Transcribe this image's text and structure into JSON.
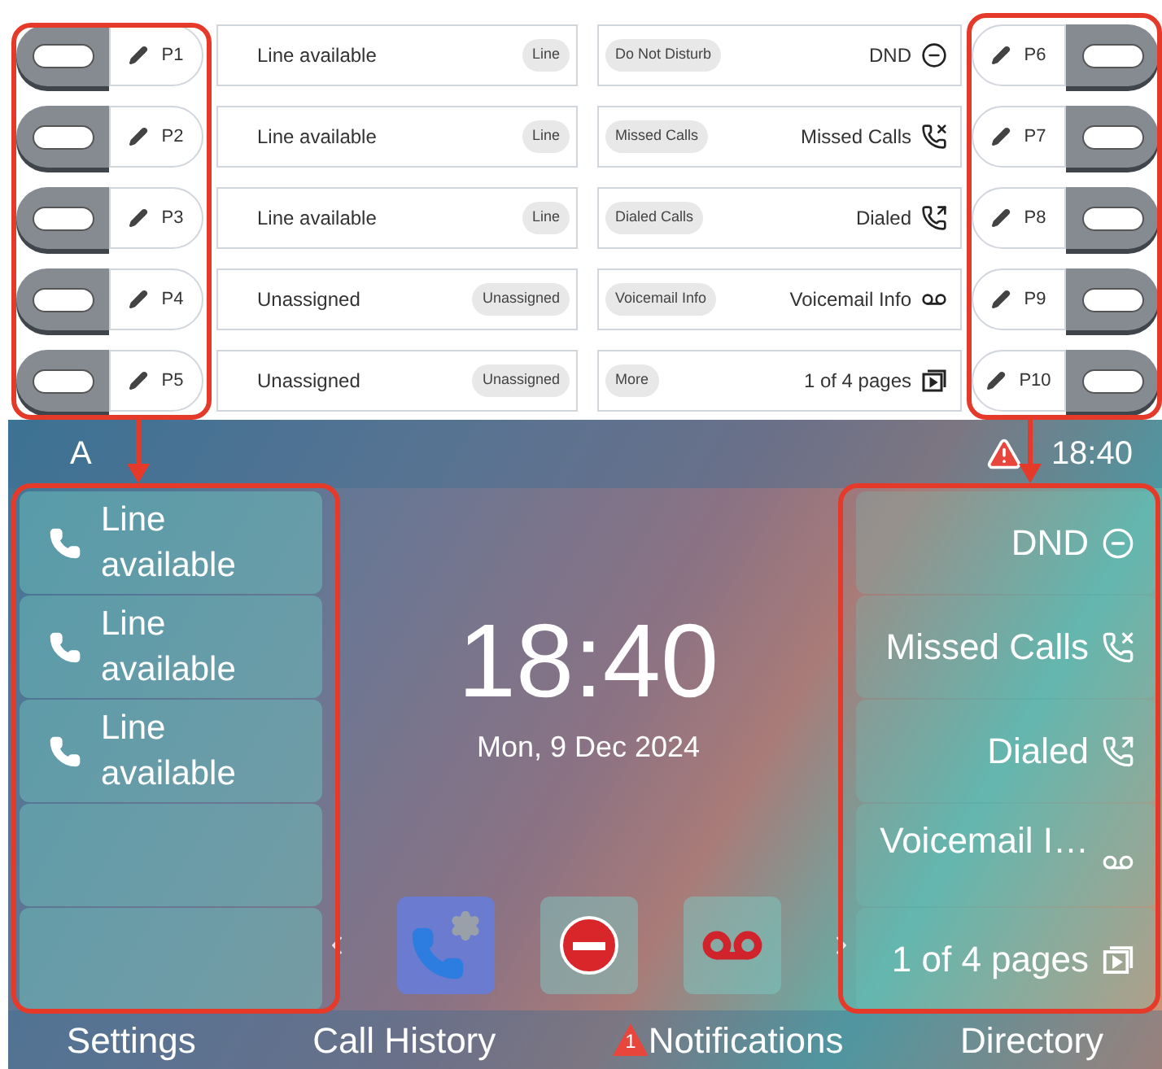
{
  "config_keys": {
    "left": [
      {
        "key": "P1",
        "label": "Line available",
        "type": "Line"
      },
      {
        "key": "P2",
        "label": "Line available",
        "type": "Line"
      },
      {
        "key": "P3",
        "label": "Line available",
        "type": "Line"
      },
      {
        "key": "P4",
        "label": "Unassigned",
        "type": "Unassigned"
      },
      {
        "key": "P5",
        "label": "Unassigned",
        "type": "Unassigned"
      }
    ],
    "right": [
      {
        "key": "P6",
        "type": "Do Not Disturb",
        "label": "DND",
        "kind": "dnd"
      },
      {
        "key": "P7",
        "type": "Missed Calls",
        "label": "Missed Calls",
        "kind": "missed"
      },
      {
        "key": "P8",
        "type": "Dialed Calls",
        "label": "Dialed",
        "kind": "dialed"
      },
      {
        "key": "P9",
        "type": "Voicemail Info",
        "label": "Voicemail Info",
        "kind": "voicemail"
      },
      {
        "key": "P10",
        "type": "More",
        "label": "1 of 4 pages",
        "kind": "pages"
      }
    ]
  },
  "phone_screen": {
    "account": "A",
    "warning": true,
    "time": "18:40",
    "line_keys": [
      {
        "label": "Line available",
        "kind": "line"
      },
      {
        "label": "Line available",
        "kind": "line"
      },
      {
        "label": "Line available",
        "kind": "line"
      }
    ],
    "function_keys": [
      {
        "label": "DND",
        "kind": "dnd"
      },
      {
        "label": "Missed Calls",
        "kind": "missed"
      },
      {
        "label": "Dialed",
        "kind": "dialed"
      },
      {
        "label": "Voicemail I…",
        "kind": "voicemail"
      },
      {
        "label": "1 of 4 pages",
        "kind": "pages"
      }
    ],
    "clock": "18:40",
    "date": "Mon, 9 Dec 2024",
    "shortcuts": [
      {
        "kind": "call-settings"
      },
      {
        "kind": "dnd"
      },
      {
        "kind": "voicemail"
      }
    ],
    "softkeys": [
      {
        "label": "Settings"
      },
      {
        "label": "Call History"
      },
      {
        "label": "Notifications",
        "badge": "1"
      },
      {
        "label": "Directory"
      }
    ]
  }
}
